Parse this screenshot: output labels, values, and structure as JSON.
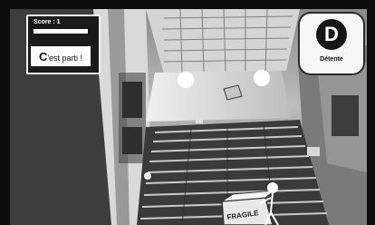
{
  "hud": {
    "score_label": "Score : 1",
    "message_initial": "C",
    "message_rest": "'est parti !"
  },
  "mode": {
    "letter": "D",
    "label": "Détente"
  },
  "scene": {
    "box_label": "FRAGILE",
    "description_icons": [
      "flying-box-icon",
      "stick-figure-icon",
      "fragile-box-icon"
    ]
  }
}
